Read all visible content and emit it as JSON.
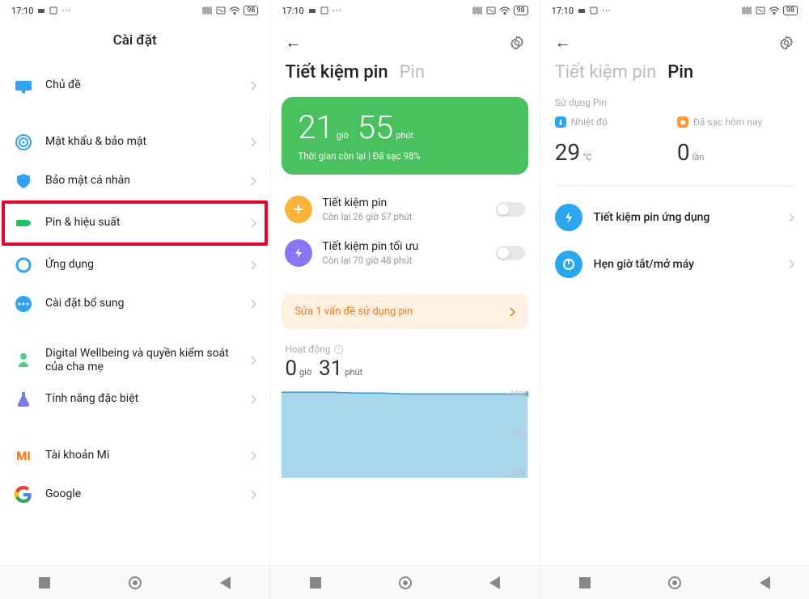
{
  "status": {
    "time": "17:10",
    "battery_pct": "98"
  },
  "screen1": {
    "title": "Cài đặt",
    "items": [
      {
        "label": "Chủ đề",
        "icon": "theme",
        "color": "#31a3f2"
      },
      {
        "label": "Mật khẩu & bảo mật",
        "icon": "fingerprint",
        "color": "#31a3f2"
      },
      {
        "label": "Bảo mật cá nhân",
        "icon": "privacy",
        "color": "#31a3f2"
      },
      {
        "label": "Pin & hiệu suất",
        "icon": "battery",
        "color": "#22c060",
        "highlight": true
      },
      {
        "label": "Ứng dụng",
        "icon": "apps",
        "color": "#31a3f2"
      },
      {
        "label": "Cài đặt bổ sung",
        "icon": "more",
        "color": "#31a3f2"
      },
      {
        "label": "Digital Wellbeing và quyền kiểm soát của cha mẹ",
        "icon": "wellbeing",
        "color": "#4ecb8e"
      },
      {
        "label": "Tính năng đặc biệt",
        "icon": "special",
        "color": "#7a79e8"
      },
      {
        "label": "Tài khoản Mi",
        "icon": "mi",
        "color": "#ff6f00"
      },
      {
        "label": "Google",
        "icon": "google",
        "color": ""
      }
    ]
  },
  "screen2": {
    "tab_active": "Tiết kiệm pin",
    "tab_inactive": "Pin",
    "card": {
      "hours": "21",
      "hours_unit": "giờ",
      "minutes": "55",
      "minutes_unit": "phút",
      "sub": "Thời gian còn lại | Đã sạc 98%"
    },
    "opts": [
      {
        "title": "Tiết kiệm pin",
        "sub": "Còn lại 26 giờ 57 phút",
        "color": "#fcb43a"
      },
      {
        "title": "Tiết kiệm pin tối ưu",
        "sub": "Còn lại 70 giờ 48 phút",
        "color": "#8a76f4"
      }
    ],
    "fix_banner": "Sửa 1 vấn đề sử dụng pin",
    "activity_label": "Hoạt động",
    "activity": {
      "h": "0",
      "h_unit": "giờ",
      "m": "31",
      "m_unit": "phút"
    }
  },
  "screen3": {
    "tab_inactive": "Tiết kiệm pin",
    "tab_active": "Pin",
    "section_label": "Sử dụng Pin",
    "stats": [
      {
        "label": "Nhiệt độ",
        "value": "29",
        "unit": "°C",
        "badge_color": "#2aa7f0"
      },
      {
        "label": "Đã sạc hôm nay",
        "value": "0",
        "unit": "lần",
        "badge_color": "#ff9a3c"
      }
    ],
    "items": [
      {
        "label": "Tiết kiệm pin ứng dụng",
        "color": "#2aa7f0"
      },
      {
        "label": "Hẹn giờ tắt/mở máy",
        "color": "#2aa7f0"
      }
    ]
  },
  "chart_data": {
    "type": "area",
    "title": "",
    "xlabel": "",
    "ylabel": "%",
    "ylim": [
      0,
      100
    ],
    "ytick_labels": [
      "100%",
      "75%",
      "50%"
    ],
    "x": [
      0,
      1,
      2,
      3,
      4,
      5,
      6,
      7,
      8,
      9,
      10
    ],
    "values": [
      99,
      99,
      99,
      98.5,
      98.5,
      98,
      98,
      98,
      98,
      98,
      98
    ]
  }
}
